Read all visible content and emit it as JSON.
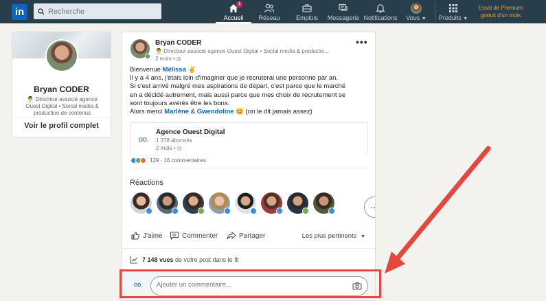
{
  "nav": {
    "logo": "in",
    "search_placeholder": "Recherche",
    "badge_count": "1",
    "items": [
      {
        "label": "Accueil",
        "icon": "home-icon"
      },
      {
        "label": "Réseau",
        "icon": "network-icon"
      },
      {
        "label": "Emplois",
        "icon": "jobs-icon"
      },
      {
        "label": "Messagerie",
        "icon": "messaging-icon"
      },
      {
        "label": "Notifications",
        "icon": "bell-icon"
      },
      {
        "label": "Vous",
        "icon": "avatar"
      },
      {
        "label": "Produits",
        "icon": "grid-icon"
      }
    ],
    "premium_line1": "Essai de Premium",
    "premium_line2": "gratuit d'un mois"
  },
  "profile": {
    "name": "Bryan CODER",
    "headline": "Directeur associé agence Ouest Digital • Social media & production de contenus",
    "view_profile": "Voir le profil complet"
  },
  "post": {
    "author": "Bryan CODER",
    "subtitle": "Directeur associé agence Ouest Digital • Social media & productio...",
    "time": "2 mois •",
    "line1_pre": "Bienvenue ",
    "mention1": "Mélissa",
    "line1_post": " ✌️",
    "line2": "Il y a 4 ans, j'étais loin d'imaginer que je recruterai une personne par an.",
    "line3": "Si c'est arrivé malgré mes aspirations de départ, c'est parce que le marché",
    "line4": "en a décidé autrement, mais aussi parce que mes choix de recrutement se",
    "line5": "sont toujours avérés être les bons.",
    "line6_pre": "Alors merci ",
    "mention2": "Marlène",
    "amp": " & ",
    "mention3": "Gwendoline",
    "line6_post": " 😊 (on le dit jamais assez)",
    "company": {
      "logo_text": "OD.",
      "name": "Agence Ouest Digital",
      "followers": "1 378 abonnés",
      "time": "2 mois •"
    },
    "counts": "129 · 16 commentaires",
    "reactions_title": "Réactions",
    "more_reactors": "...",
    "actions": {
      "like": "J'aime",
      "comment": "Commenter",
      "share": "Partager",
      "sort": "Les plus pertinents"
    },
    "views_count": "7 148 vues",
    "views_text": " de votre post dans le fil",
    "comment_logo": "OD.",
    "comment_placeholder": "Ajouter un commentaire..."
  },
  "colors": {
    "topbar": "#283e4a",
    "link": "#0a66c2",
    "annotation": "#e5473f"
  }
}
